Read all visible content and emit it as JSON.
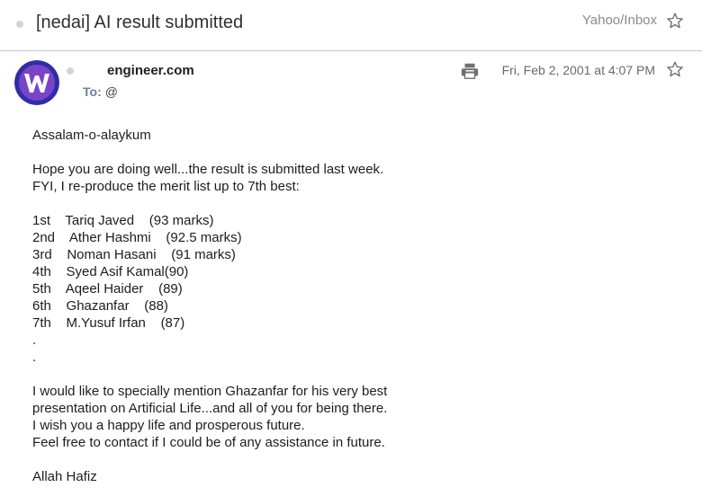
{
  "subject": {
    "title": "[nedai] AI result submitted",
    "folder": "Yahoo/Inbox",
    "star_icon": "star-outline-icon"
  },
  "message": {
    "avatar_letter": "W",
    "avatar_colors": {
      "ring": "#3a3ab0",
      "fill": "#7b3fc6",
      "letter": "#ffffff"
    },
    "sender": "engineer.com",
    "to_label": "To:",
    "to_value": "@",
    "date": "Fri, Feb 2, 2001 at 4:07 PM",
    "print_icon": "printer-icon",
    "star_icon": "star-outline-icon"
  },
  "body_lines": [
    "Assalam-o-alaykum",
    "",
    "Hope you are doing well...the result is submitted last week.",
    "FYI, I re-produce the merit list up to 7th best:",
    "",
    "1st    Tariq Javed    (93 marks)",
    "2nd    Ather Hashmi    (92.5 marks)",
    "3rd    Noman Hasani    (91 marks)",
    "4th    Syed Asif Kamal(90)",
    "5th    Aqeel Haider    (89)",
    "6th    Ghazanfar    (88)",
    "7th    M.Yusuf Irfan    (87)",
    ".",
    ".",
    "",
    "I would like to specially mention Ghazanfar for his very best",
    "presentation on Artificial Life...and all of you for being there.",
    "I wish you a happy life and prosperous future.",
    "Feel free to contact if I could be of any assistance in future.",
    "",
    "Allah Hafiz"
  ]
}
